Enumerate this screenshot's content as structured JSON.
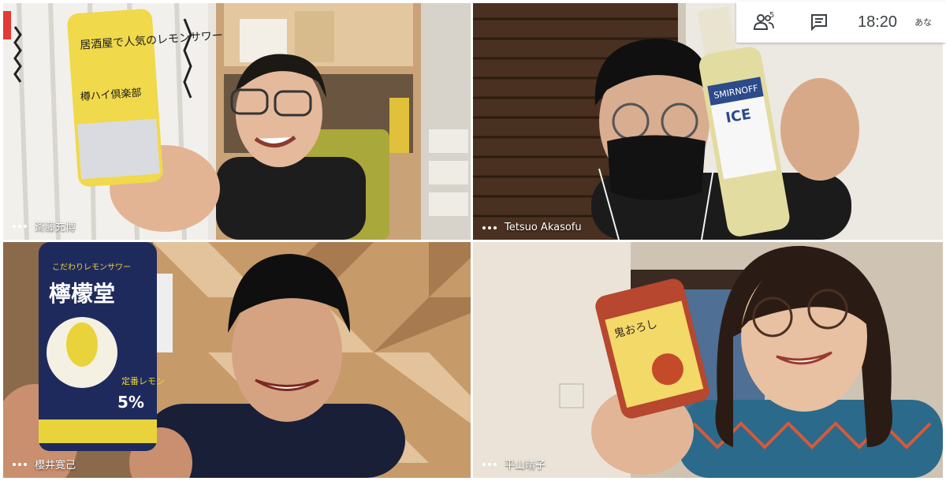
{
  "participants": [
    {
      "name": "斎藤充博"
    },
    {
      "name": "Tetsuo Akasofu"
    },
    {
      "name": "櫻井寛己"
    },
    {
      "name": "平山晴子"
    }
  ],
  "can_labels": {
    "can1_text": "居酒屋で人気のレモンサワー",
    "can1_brand": "樽ハイ倶楽部",
    "bottle_brand": "SMIRNOFF",
    "bottle_product": "ICE",
    "can3_sub": "こだわりレモンサワー",
    "can3_brand": "檸檬堂",
    "can3_type": "定番レモン",
    "can3_abv": "5%",
    "can4_text": "鬼おろし"
  },
  "toolbar": {
    "people_count": "5",
    "time": "18:20",
    "you_label": "あな"
  },
  "colors": {
    "tile_text": "#ffffff",
    "toolbar_bg": "#ffffff",
    "icon": "#3c4043",
    "marker": "#e53935"
  }
}
